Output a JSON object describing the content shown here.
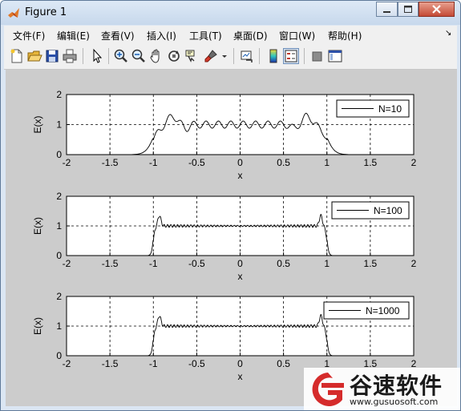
{
  "window": {
    "title": "Figure 1"
  },
  "menu": [
    "文件(F)",
    "编辑(E)",
    "查看(V)",
    "插入(I)",
    "工具(T)",
    "桌面(D)",
    "窗口(W)",
    "帮助(H)"
  ],
  "menu_arrow": "↘",
  "toolbar": [
    {
      "name": "new-figure-icon"
    },
    {
      "name": "open-file-icon"
    },
    {
      "name": "save-icon"
    },
    {
      "name": "print-icon"
    },
    {
      "name": "edit-plot-icon"
    },
    {
      "name": "zoom-in-icon"
    },
    {
      "name": "zoom-out-icon"
    },
    {
      "name": "pan-icon"
    },
    {
      "name": "rotate-3d-icon"
    },
    {
      "name": "data-cursor-icon"
    },
    {
      "name": "brush-icon"
    },
    {
      "name": "link-plot-icon"
    },
    {
      "name": "insert-colorbar-icon"
    },
    {
      "name": "insert-legend-icon"
    },
    {
      "name": "hide-plot-tools-icon"
    },
    {
      "name": "show-plot-tools-icon"
    }
  ],
  "watermark": {
    "text": "谷速软件",
    "url": "www.gusuosoft.com"
  },
  "chart_data": [
    {
      "type": "line",
      "xlabel": "x",
      "ylabel": "E(x)",
      "xlim": [
        -2,
        2
      ],
      "ylim": [
        0,
        2
      ],
      "xticks": [
        "-2",
        "-1.5",
        "-1",
        "-0.5",
        "0",
        "0.5",
        "1",
        "1.5",
        "2"
      ],
      "yticks": [
        "0",
        "1",
        "2"
      ],
      "grid": true,
      "legend_position": "top-right",
      "series": [
        {
          "name": "N=10",
          "N": 10,
          "color": "#000000"
        }
      ]
    },
    {
      "type": "line",
      "xlabel": "x",
      "ylabel": "E(x)",
      "xlim": [
        -2,
        2
      ],
      "ylim": [
        0,
        2
      ],
      "xticks": [
        "-2",
        "-1.5",
        "-1",
        "-0.5",
        "0",
        "0.5",
        "1",
        "1.5",
        "2"
      ],
      "yticks": [
        "0",
        "1",
        "2"
      ],
      "grid": true,
      "legend_position": "top-right",
      "series": [
        {
          "name": "N=100",
          "N": 100,
          "color": "#000000"
        }
      ]
    },
    {
      "type": "line",
      "xlabel": "x",
      "ylabel": "E(x)",
      "xlim": [
        -2,
        2
      ],
      "ylim": [
        0,
        2
      ],
      "xticks": [
        "-2",
        "-1.5",
        "-1",
        "-0.5",
        "0",
        "0.5",
        "1",
        "1.5",
        "2"
      ],
      "yticks": [
        "0",
        "1",
        "2"
      ],
      "grid": true,
      "legend_position": "top-right",
      "series": [
        {
          "name": "N=1000",
          "N": 1000,
          "color": "#000000"
        }
      ]
    }
  ]
}
